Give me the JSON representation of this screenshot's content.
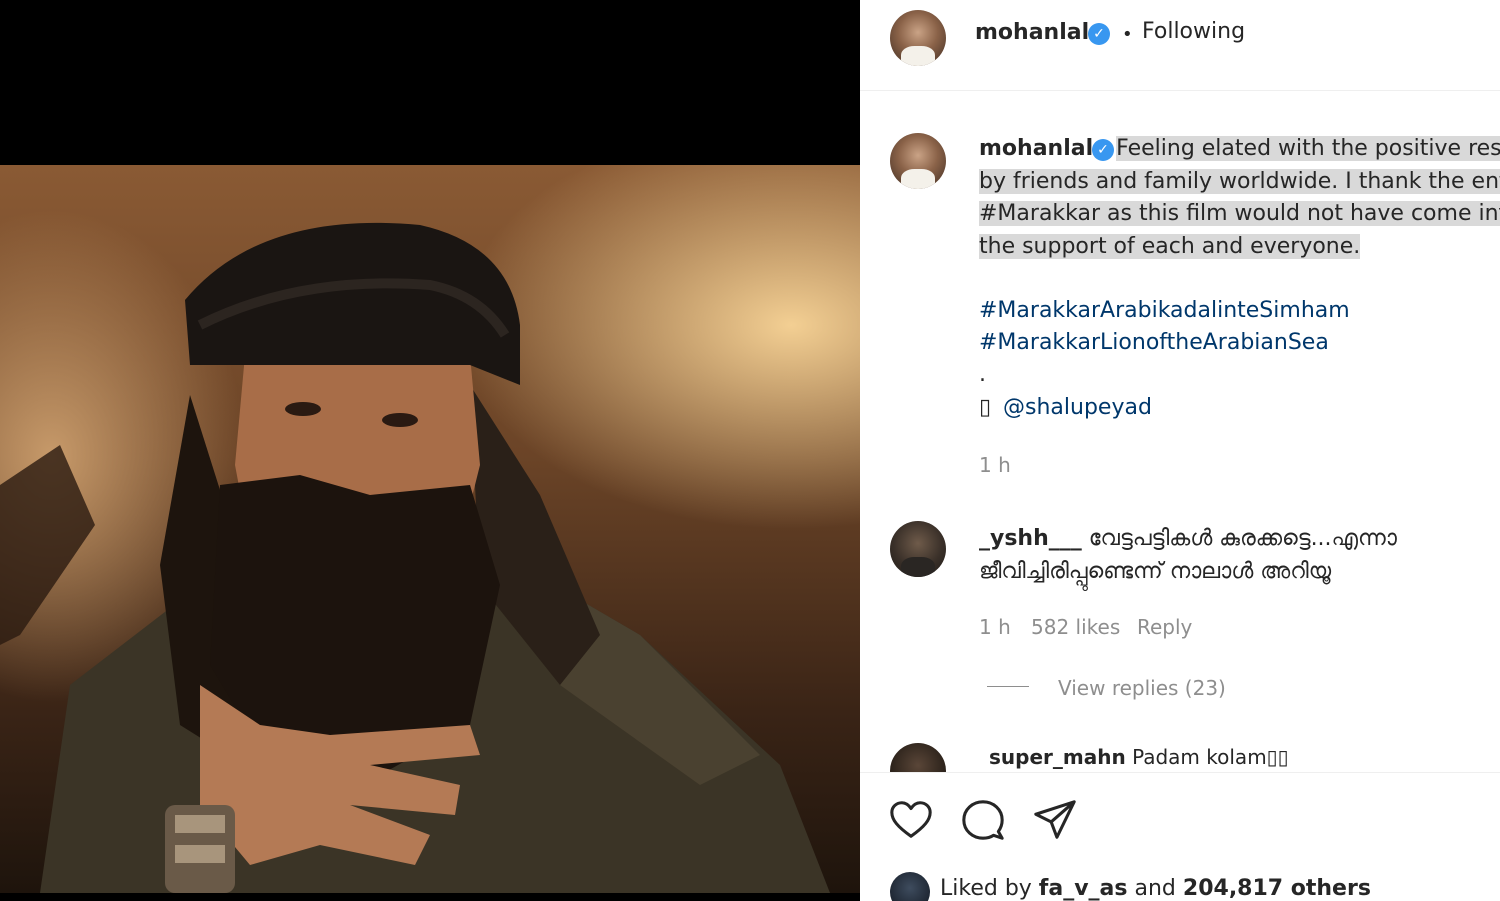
{
  "post": {
    "username": "mohanlal",
    "verified_mark": "✓",
    "separator": "•",
    "follow_status": "Following"
  },
  "caption": {
    "username": "mohanlal",
    "line1": "Feeling elated with the positive res",
    "line2": "by friends and family worldwide. I thank the ent",
    "line3": "#Marakkar as this film would not have come int",
    "line4": "the support of each and everyone.",
    "hashtag1": "#MarakkarArabikadalinteSimham",
    "hashtag2": "#MarakkarLionoftheArabianSea",
    "dot": ".",
    "credit_icon": "▯",
    "credit": "@shalupeyad",
    "time": "1 h"
  },
  "comment": {
    "username": "_yshh___",
    "text_line1": "വേട്ടപട്ടികൾ കുരക്കട്ടെ...എന്നാ",
    "text_line2": "ജീവിച്ചിരിപ്പുണ്ടെന്ന് നാലാൾ അറിയൂ",
    "time": "1 h",
    "likes": "582 likes",
    "reply": "Reply",
    "view_replies": "View replies (23)"
  },
  "next_comment": {
    "username": "super_mahn",
    "text": "Padam kolam▯▯"
  },
  "actions": {
    "like_icon": "heart-icon",
    "comment_icon": "comment-icon",
    "share_icon": "share-icon"
  },
  "liked_by": {
    "prefix": "Liked by ",
    "user": "fa_v_as",
    "middle": " and ",
    "count": "204,817 others"
  },
  "colors": {
    "verified": "#3897f0",
    "link": "#00376b",
    "muted": "#8e8e8e",
    "highlight": "#d9d9d9"
  }
}
